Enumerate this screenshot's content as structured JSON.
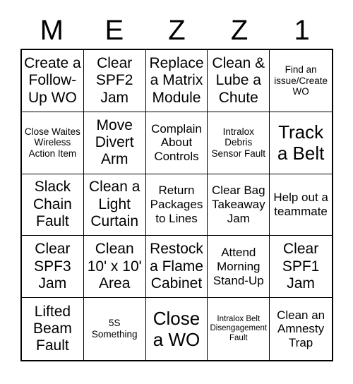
{
  "card": {
    "title_letters": [
      "M",
      "E",
      "Z",
      "Z",
      "1"
    ],
    "grid_size": "5x5",
    "cells": [
      {
        "text": "Create a Follow-Up WO",
        "size": "lg"
      },
      {
        "text": "Clear SPF2 Jam",
        "size": "lg"
      },
      {
        "text": "Replace a Matrix Module",
        "size": "lg"
      },
      {
        "text": "Clean & Lube a Chute",
        "size": "lg"
      },
      {
        "text": "Find an issue/Create WO",
        "size": "sm"
      },
      {
        "text": "Close Waites Wireless Action Item",
        "size": "sm"
      },
      {
        "text": "Move Divert Arm",
        "size": "lg"
      },
      {
        "text": "Complain About Controls",
        "size": "md"
      },
      {
        "text": "Intralox Debris Sensor Fault",
        "size": "sm"
      },
      {
        "text": "Track a Belt",
        "size": "xl"
      },
      {
        "text": "Slack Chain Fault",
        "size": "lg"
      },
      {
        "text": "Clean a Light Curtain",
        "size": "lg"
      },
      {
        "text": "Return Packages to Lines",
        "size": "md"
      },
      {
        "text": "Clear Bag Takeaway Jam",
        "size": "md"
      },
      {
        "text": "Help out a teammate",
        "size": "md"
      },
      {
        "text": "Clear SPF3 Jam",
        "size": "lg"
      },
      {
        "text": "Clean 10' x 10' Area",
        "size": "lg"
      },
      {
        "text": "Restock a Flame Cabinet",
        "size": "lg"
      },
      {
        "text": "Attend Morning Stand-Up",
        "size": "md"
      },
      {
        "text": "Clear SPF1 Jam",
        "size": "lg"
      },
      {
        "text": "Lifted Beam Fault",
        "size": "lg"
      },
      {
        "text": "5S Something",
        "size": "sm"
      },
      {
        "text": "Close a WO",
        "size": "xl"
      },
      {
        "text": "Intralox Belt Disengagement Fault",
        "size": "xs"
      },
      {
        "text": "Clean an Amnesty Trap",
        "size": "md"
      }
    ]
  },
  "colors": {
    "background": "#ffffff",
    "text": "#000000",
    "grid_line": "#000000"
  }
}
